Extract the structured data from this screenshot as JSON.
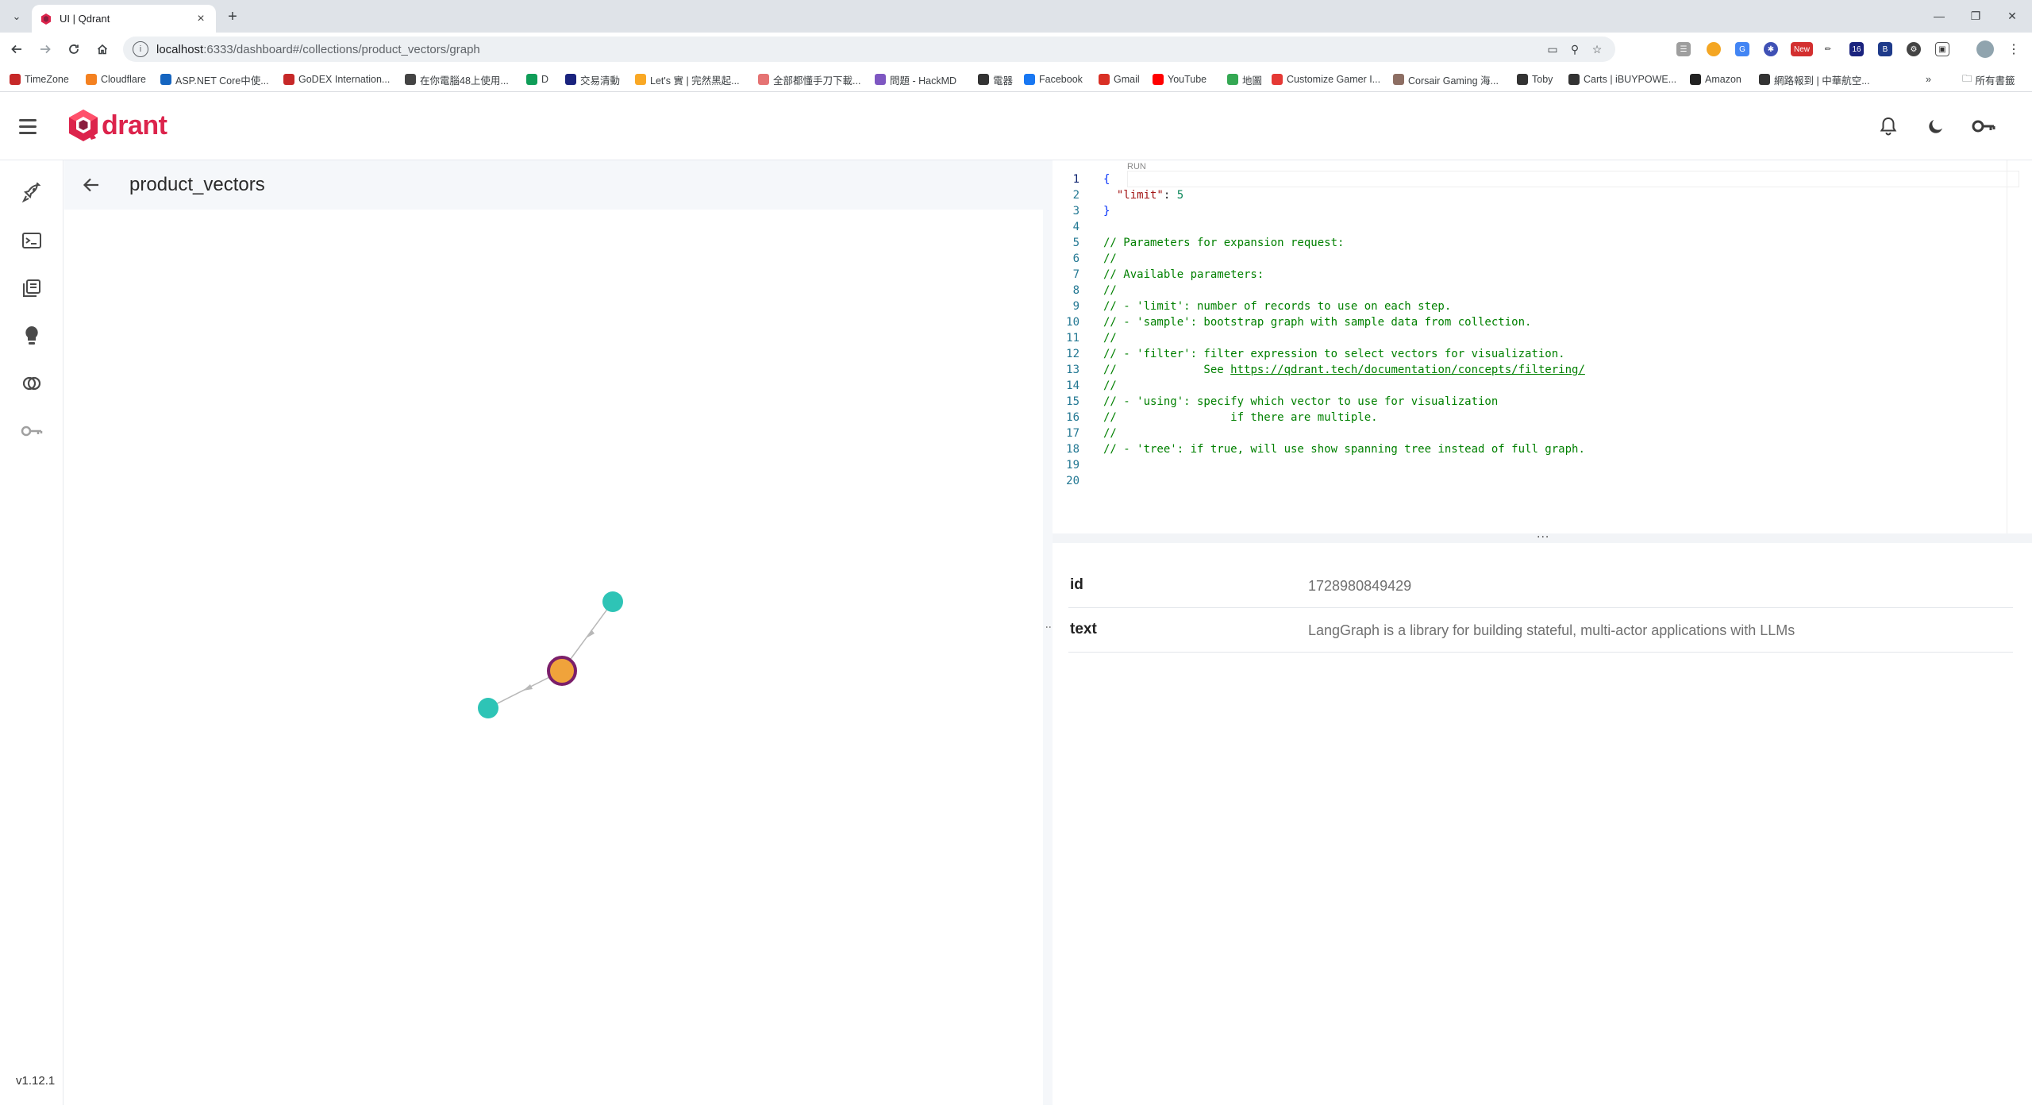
{
  "browser": {
    "tab_title": "UI | Qdrant",
    "url_host": "localhost",
    "url_rest": ":6333/dashboard#/collections/product_vectors/graph",
    "bookmarks": [
      {
        "label": "TimeZone",
        "color": "#c62828"
      },
      {
        "label": "Cloudflare",
        "color": "#f48120"
      },
      {
        "label": "ASP.NET Core中使...",
        "color": "#1565c0"
      },
      {
        "label": "GoDEX Internation...",
        "color": "#c62828"
      },
      {
        "label": "在你電腦48上使用...",
        "color": "#444444"
      },
      {
        "label": "D",
        "color": "#0f9d58"
      },
      {
        "label": "交易清動",
        "color": "#1a237e"
      },
      {
        "label": "Let's 實 | 完然黑起...",
        "color": "#f9a825"
      },
      {
        "label": "全部都懂手刀下載...",
        "color": "#e57373"
      },
      {
        "label": "問題 - HackMD",
        "color": "#7e57c2"
      },
      {
        "label": "電器",
        "color": "#333333"
      },
      {
        "label": "Facebook",
        "color": "#1877f2"
      },
      {
        "label": "Gmail",
        "color": "#d93025"
      },
      {
        "label": "YouTube",
        "color": "#ff0000"
      },
      {
        "label": "地圖",
        "color": "#34a853"
      },
      {
        "label": "Customize Gamer I...",
        "color": "#e53935"
      },
      {
        "label": "Corsair Gaming 海...",
        "color": "#8d6e63"
      },
      {
        "label": "Toby",
        "color": "#333333"
      },
      {
        "label": "Carts | iBUYPOWE...",
        "color": "#333333"
      },
      {
        "label": "Amazon",
        "color": "#222222"
      },
      {
        "label": "網路報到 | 中華航空...",
        "color": "#333333"
      }
    ],
    "bookmarks_folder": "所有書籤"
  },
  "app": {
    "logo_text": "drant",
    "version": "v1.12.1",
    "collection_name": "product_vectors",
    "run_label": "RUN",
    "code_lines": [
      {
        "n": "1",
        "text": "{",
        "kind": "punc"
      },
      {
        "n": "2",
        "key": "\"limit\"",
        "sep": ": ",
        "num": "5",
        "kind": "kv"
      },
      {
        "n": "3",
        "text": "}",
        "kind": "punc"
      },
      {
        "n": "4",
        "text": "",
        "kind": "plain"
      },
      {
        "n": "5",
        "text": "// Parameters for expansion request:",
        "kind": "com"
      },
      {
        "n": "6",
        "text": "//",
        "kind": "com"
      },
      {
        "n": "7",
        "text": "// Available parameters:",
        "kind": "com"
      },
      {
        "n": "8",
        "text": "//",
        "kind": "com"
      },
      {
        "n": "9",
        "text": "// - 'limit': number of records to use on each step.",
        "kind": "com"
      },
      {
        "n": "10",
        "text": "// - 'sample': bootstrap graph with sample data from collection.",
        "kind": "com"
      },
      {
        "n": "11",
        "text": "//",
        "kind": "com"
      },
      {
        "n": "12",
        "text": "// - 'filter': filter expression to select vectors for visualization.",
        "kind": "com"
      },
      {
        "n": "13",
        "text": "//             See ",
        "link": "https://qdrant.tech/documentation/concepts/filtering/",
        "kind": "link"
      },
      {
        "n": "14",
        "text": "//",
        "kind": "com"
      },
      {
        "n": "15",
        "text": "// - 'using': specify which vector to use for visualization",
        "kind": "com"
      },
      {
        "n": "16",
        "text": "//                 if there are multiple.",
        "kind": "com"
      },
      {
        "n": "17",
        "text": "//",
        "kind": "com"
      },
      {
        "n": "18",
        "text": "// - 'tree': if true, will use show spanning tree instead of full graph.",
        "kind": "com"
      },
      {
        "n": "19",
        "text": "",
        "kind": "plain"
      },
      {
        "n": "20",
        "text": "",
        "kind": "plain"
      }
    ],
    "payload": [
      {
        "key": "id",
        "value": "1728980849429"
      },
      {
        "key": "text",
        "value": "LangGraph is a library for building stateful, multi-actor applications with LLMs"
      }
    ],
    "graph": {
      "selected_color": "#f0a33b",
      "selected_stroke": "#7b1f6a",
      "neighbor_color": "#2ec4b6"
    }
  }
}
